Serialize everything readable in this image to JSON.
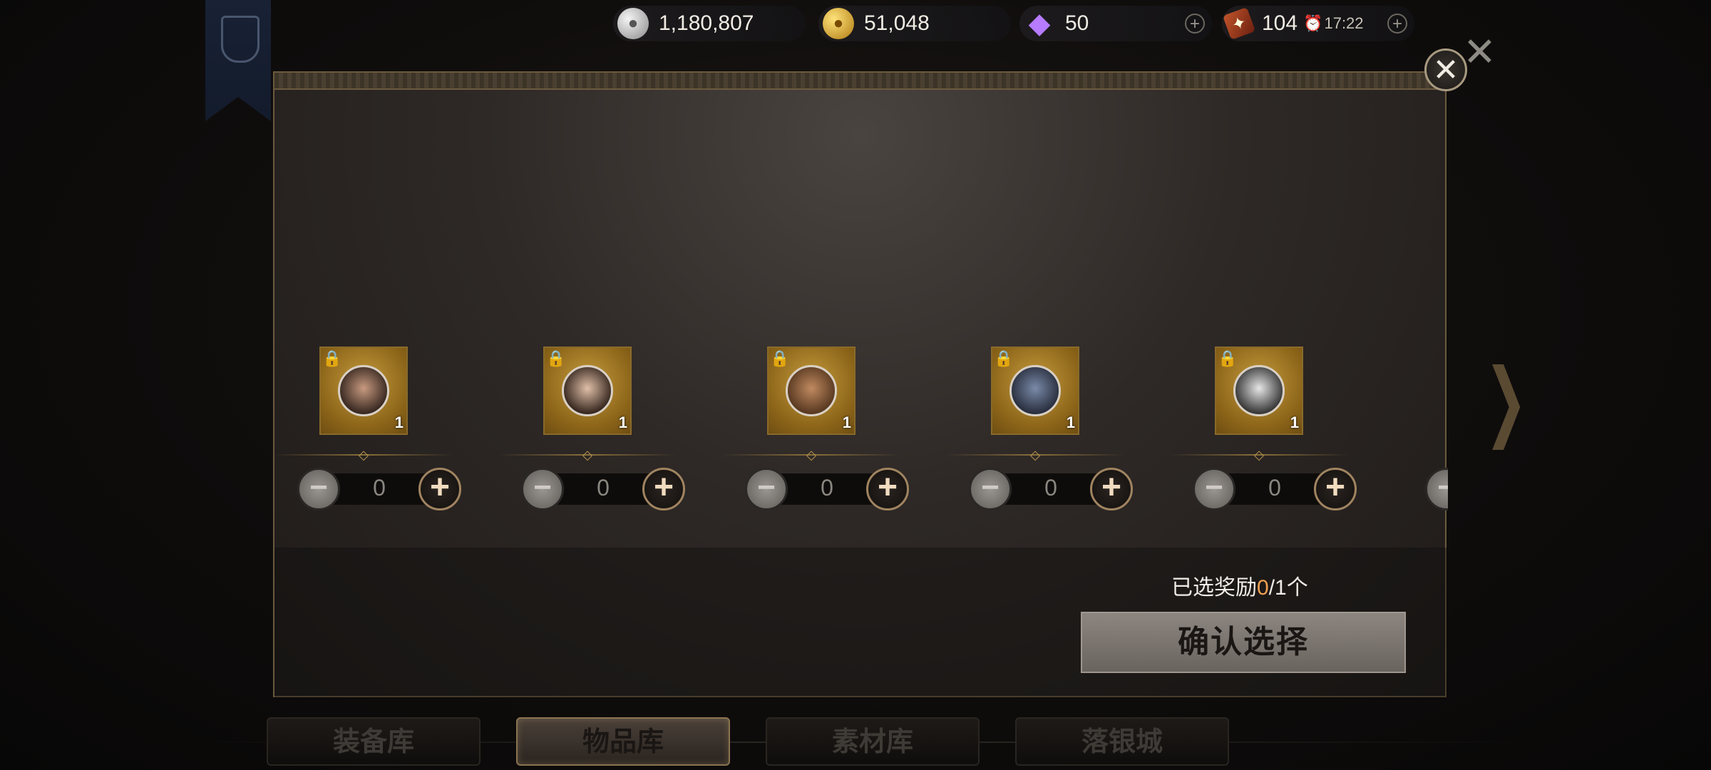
{
  "resources": {
    "silver": {
      "value": "1,180,807",
      "icon": "silver-coin-icon"
    },
    "gold": {
      "value": "51,048",
      "icon": "gold-coin-icon"
    },
    "gem": {
      "value": "50",
      "icon": "diamond-icon"
    },
    "stamina": {
      "value": "104",
      "timer": "17:22",
      "icon": "book-icon"
    }
  },
  "items": [
    {
      "count": "1",
      "quantity": "0"
    },
    {
      "count": "1",
      "quantity": "0"
    },
    {
      "count": "1",
      "quantity": "0"
    },
    {
      "count": "1",
      "quantity": "0"
    },
    {
      "count": "1",
      "quantity": "0"
    }
  ],
  "selection": {
    "prefix": "已选奖励",
    "selected": "0",
    "suffix": "/1个"
  },
  "confirm_label": "确认选择",
  "tabs": [
    {
      "label": "装备库"
    },
    {
      "label": "物品库"
    },
    {
      "label": "素材库"
    },
    {
      "label": "落银城"
    }
  ],
  "colors": {
    "highlight": "#f0a050",
    "slot_gold": "#c59a3c"
  }
}
